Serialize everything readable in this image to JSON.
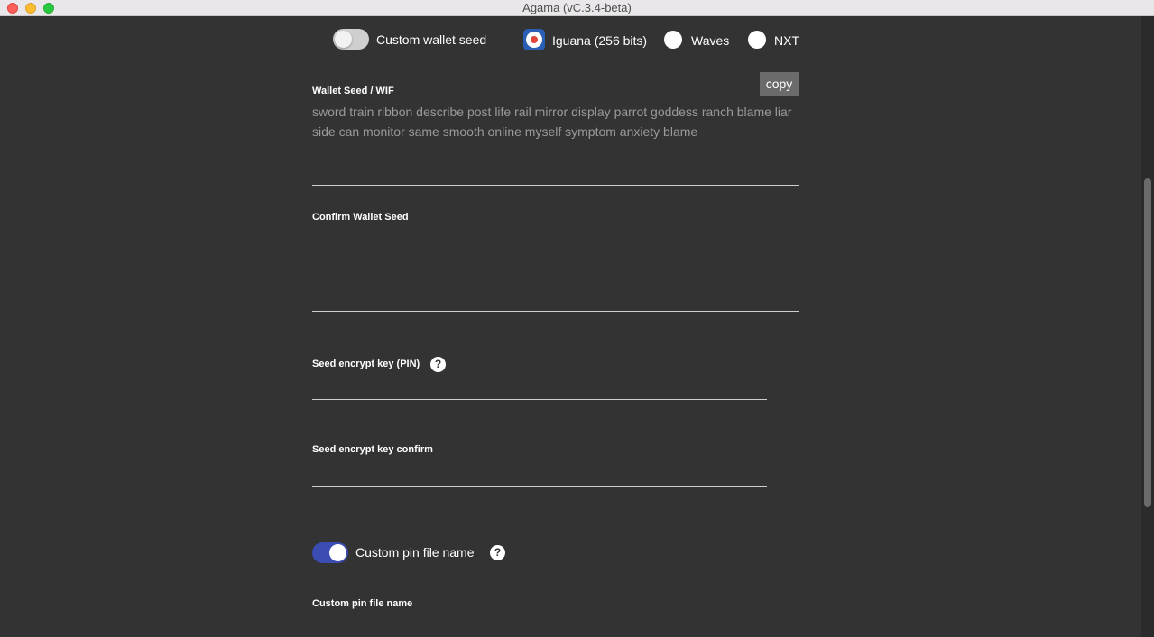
{
  "window": {
    "title": "Agama (vC.3.4-beta)"
  },
  "seed_options": {
    "custom_wallet_seed_label": "Custom wallet seed",
    "custom_wallet_seed_enabled": false,
    "radio_options": [
      "Iguana (256 bits)",
      "Waves",
      "NXT"
    ],
    "selected": "Iguana (256 bits)"
  },
  "wallet_seed": {
    "label": "Wallet Seed / WIF",
    "value": "sword train ribbon describe post life rail mirror display parrot goddess ranch blame liar side can monitor same smooth online myself symptom anxiety blame",
    "copy_label": "copy"
  },
  "confirm_seed": {
    "label": "Confirm Wallet Seed",
    "value": ""
  },
  "pin": {
    "label": "Seed encrypt key (PIN)",
    "help_glyph": "?",
    "value": "",
    "confirm_label": "Seed encrypt key confirm",
    "confirm_value": ""
  },
  "pin_file": {
    "toggle_label": "Custom pin file name",
    "toggle_enabled": true,
    "help_glyph": "?",
    "field_label": "Custom pin file name"
  },
  "colors": {
    "background": "#333333",
    "accent": "#3b4cb3",
    "radio_checked": "#2b5fb5",
    "radio_dot": "#e0463b"
  }
}
